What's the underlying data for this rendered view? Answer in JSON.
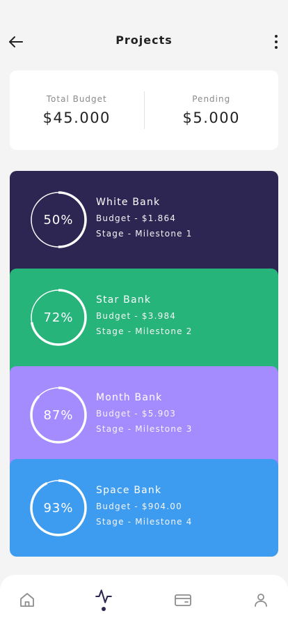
{
  "header": {
    "title": "Projects",
    "back_icon": "arrow-left-icon",
    "more_icon": "more-vertical-icon"
  },
  "summary": {
    "total_label": "Total Budget",
    "total_value": "$45.000",
    "pending_label": "Pending",
    "pending_value": "$5.000"
  },
  "projects": [
    {
      "name": "White Bank",
      "budget": "Budget - $1.864",
      "stage": "Stage - Milestone 1",
      "percent_label": "50%",
      "progress": 0.5,
      "color": "#2d2552"
    },
    {
      "name": "Star Bank",
      "budget": "Budget - $3.984",
      "stage": "Stage - Milestone 2",
      "percent_label": "72%",
      "progress": 0.72,
      "color": "#27b47a"
    },
    {
      "name": "Month Bank",
      "budget": "Budget - $5.903",
      "stage": "Stage - Milestone 3",
      "percent_label": "87%",
      "progress": 0.87,
      "color": "#a48cff"
    },
    {
      "name": "Space Bank",
      "budget": "Budget - $904.00",
      "stage": "Stage - Milestone 4",
      "percent_label": "93%",
      "progress": 0.93,
      "color": "#3e9cf0"
    }
  ],
  "bottom_nav": {
    "items": [
      {
        "icon": "home-icon"
      },
      {
        "icon": "activity-icon",
        "active": true
      },
      {
        "icon": "wallet-icon"
      },
      {
        "icon": "user-icon"
      }
    ],
    "accent_color": "#2d2552",
    "inactive_color": "#8d8d8d"
  }
}
